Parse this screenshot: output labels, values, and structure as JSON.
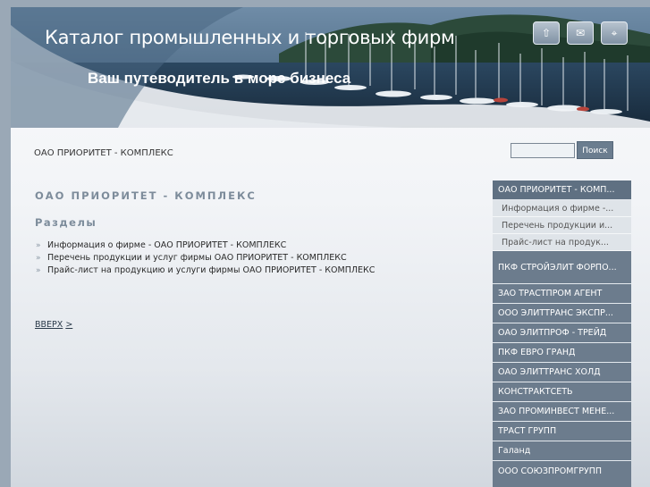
{
  "header": {
    "title": "Каталог промышленных и торговых фирм",
    "slogan": "Ваш путеводитель в море бизнеса",
    "icons": [
      {
        "name": "home-icon",
        "glyph": "⇧"
      },
      {
        "name": "mail-icon",
        "glyph": "✉"
      },
      {
        "name": "sitemap-icon",
        "glyph": "⌖"
      }
    ]
  },
  "breadcrumb": "ОАО ПРИОРИТЕТ - КОМПЛЕКС",
  "search": {
    "value": "",
    "button_label": "Поиск"
  },
  "content": {
    "title": "ОАО ПРИОРИТЕТ - КОМПЛЕКС",
    "sections_heading": "Разделы",
    "sections": [
      "Информация о фирме - ОАО ПРИОРИТЕТ - КОМПЛЕКС",
      "Перечень продукции и услуг фирмы ОАО ПРИОРИТЕТ - КОМПЛЕКС",
      "Прайс-лист на продукцию и услуги фирмы ОАО ПРИОРИТЕТ - КОМПЛЕКС"
    ],
    "bullet": "»",
    "up_link": "ВВЕРХ",
    "up_arrow": ">"
  },
  "sidebar": {
    "active_item": "ОАО ПРИОРИТЕТ - КОМП...",
    "sub_items": [
      "Информация о фирме -...",
      "Перечень продукции и...",
      "Прайс-лист на продук..."
    ],
    "items": [
      "ПКФ СТРОЙЭЛИТ ФОРПО...",
      "ЗАО ТРАСТПРОМ АГЕНТ",
      "ООО ЭЛИТТРАНС ЭКСПР...",
      "ОАО ЭЛИТПРОФ - ТРЕЙД",
      "ПКФ ЕВРО ГРАНД",
      "ОАО ЭЛИТТРАНС ХОЛД",
      "КОНСТРАКТСЕТЬ",
      "ЗАО ПРОМИНВЕСТ МЕНЕ...",
      "ТРАСТ ГРУПП",
      "Галанд",
      "ООО СОЮЗПРОМГРУПП"
    ]
  },
  "colors": {
    "menu_bg": "#6c7c8d",
    "submenu_bg": "#dfe4e9",
    "heading": "#7d8c9b",
    "search_button": "#6b7d8f"
  }
}
